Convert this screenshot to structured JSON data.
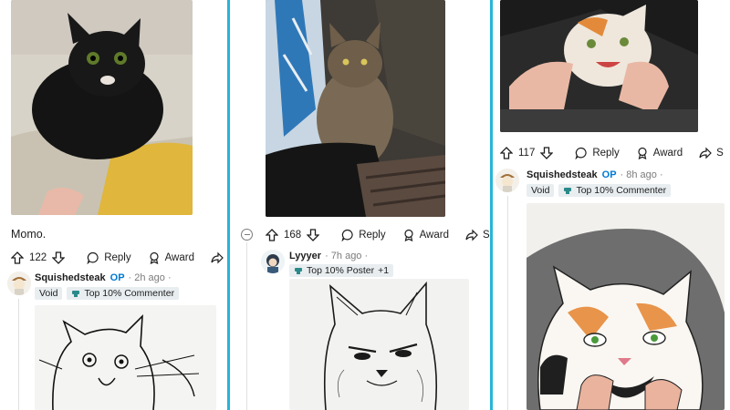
{
  "columns": [
    {
      "caption": "Momo.",
      "vote_count": "122",
      "actions": {
        "reply": "Reply",
        "award": "Award",
        "share": "Sh"
      },
      "comment": {
        "username": "Squishedsteak",
        "op": "OP",
        "time": "· 2h ago ·",
        "flairs": [
          "Void",
          "Top 10% Commenter"
        ]
      }
    },
    {
      "vote_count": "168",
      "actions": {
        "reply": "Reply",
        "award": "Award",
        "share": "Shar"
      },
      "comment": {
        "username": "Lyyyer",
        "time": "· 7h ago ·",
        "flairs": [
          "Top 10% Poster",
          "+1"
        ]
      }
    },
    {
      "vote_count": "117",
      "actions": {
        "reply": "Reply",
        "award": "Award",
        "share": "S"
      },
      "comment": {
        "username": "Squishedsteak",
        "op": "OP",
        "time": "· 8h ago ·",
        "flairs": [
          "Void",
          "Top 10% Commenter"
        ]
      }
    }
  ],
  "colors": {
    "divider": "#26b5d8",
    "op": "#0079d3",
    "flair_bg": "#e8edf0"
  },
  "icons": [
    "upvote-icon",
    "downvote-icon",
    "comment-icon",
    "award-icon",
    "share-icon",
    "collapse-icon",
    "trophy-icon"
  ]
}
